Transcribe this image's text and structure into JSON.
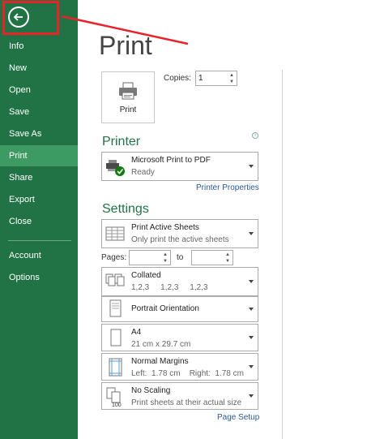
{
  "sidebar": {
    "back_icon": "arrow-left-icon",
    "items": [
      {
        "label": "Info"
      },
      {
        "label": "New"
      },
      {
        "label": "Open"
      },
      {
        "label": "Save"
      },
      {
        "label": "Save As"
      },
      {
        "label": "Print",
        "active": true
      },
      {
        "label": "Share"
      },
      {
        "label": "Export"
      },
      {
        "label": "Close"
      },
      {
        "label": "Account"
      },
      {
        "label": "Options"
      }
    ]
  },
  "colors": {
    "accent": "#217346",
    "active": "#3c9a62",
    "annotation": "#e8232a",
    "link": "#2b579a"
  },
  "main": {
    "title": "Print",
    "print_button_label": "Print",
    "copies_label": "Copies:",
    "copies_value": "1",
    "printer_heading": "Printer",
    "printer": {
      "name": "Microsoft Print to PDF",
      "status": "Ready"
    },
    "printer_properties": "Printer Properties",
    "settings_heading": "Settings",
    "settings": {
      "print_what": {
        "title": "Print Active Sheets",
        "subtitle": "Only print the active sheets"
      },
      "pages_label": "Pages:",
      "pages_from": "",
      "to_label": "to",
      "pages_to": "",
      "collation": {
        "title": "Collated",
        "subtitle": "1,2,3     1,2,3     1,2,3"
      },
      "orientation": {
        "title": "Portrait Orientation"
      },
      "paper": {
        "title": "A4",
        "subtitle": "21 cm x 29.7 cm"
      },
      "margins": {
        "title": "Normal Margins",
        "subtitle": "Left:  1.78 cm    Right:  1.78 cm"
      },
      "scaling": {
        "title": "No Scaling",
        "subtitle": "Print sheets at their actual size"
      }
    },
    "page_setup": "Page Setup"
  }
}
